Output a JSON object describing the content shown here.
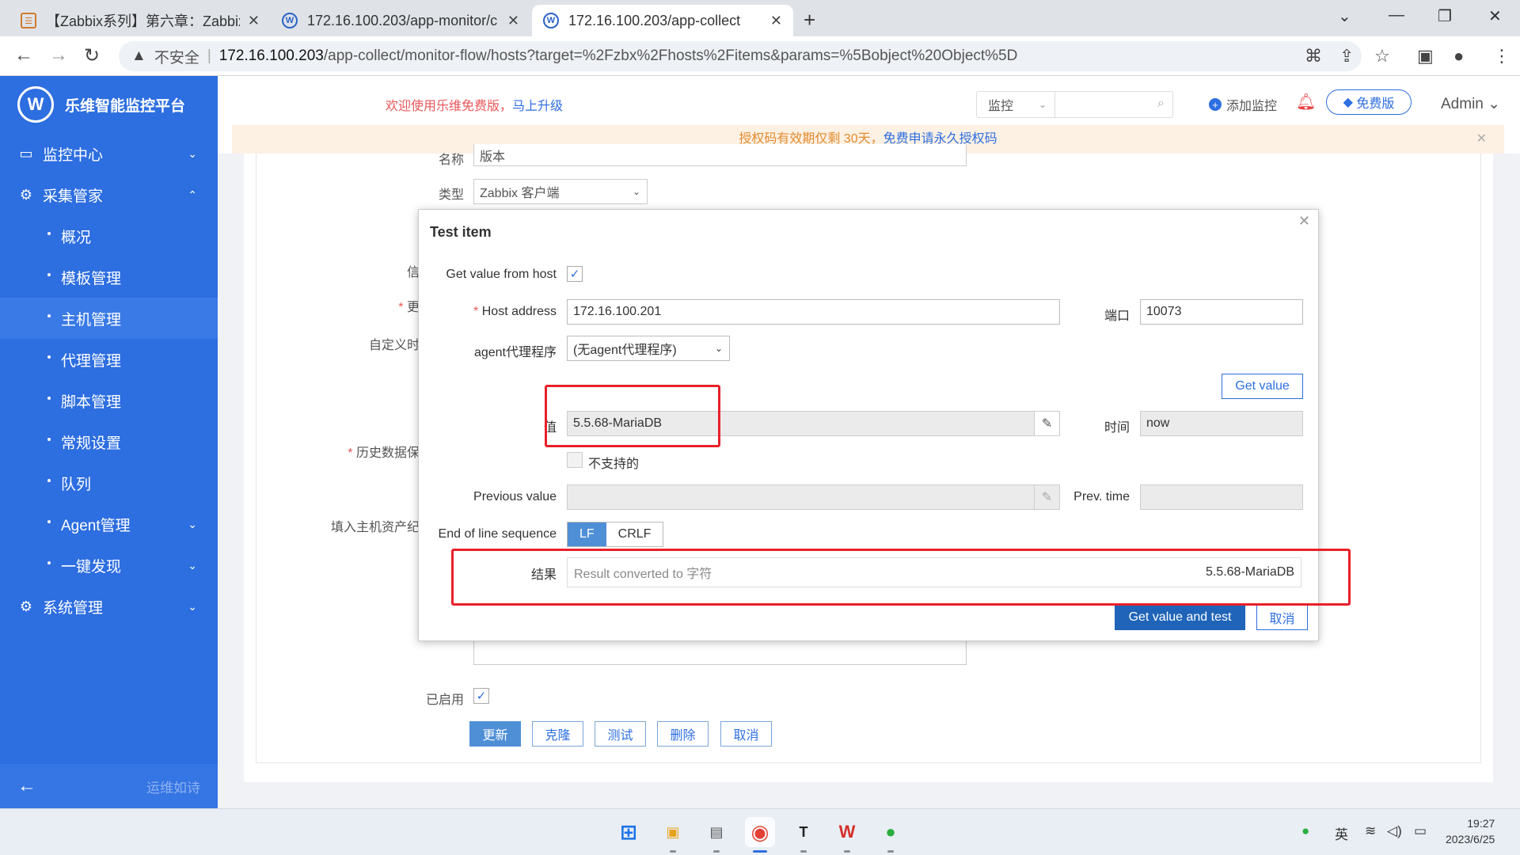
{
  "browser": {
    "tabs": [
      {
        "title": "【Zabbix系列】第六章：Zabbix",
        "active": false
      },
      {
        "title": "172.16.100.203/app-monitor/c",
        "active": false
      },
      {
        "title": "172.16.100.203/app-collect",
        "active": true
      }
    ],
    "security": "不安全",
    "url_host": "172.16.100.203",
    "url_path": "/app-collect/monitor-flow/hosts?target=%2Fzbx%2Fhosts%2Fitems&params=%5Bobject%20Object%5D"
  },
  "sidebar": {
    "brand": "乐维智能监控平台",
    "logo_letter": "W",
    "menu": [
      {
        "label": "监控中心",
        "icon": "monitor-icon",
        "expanded": false
      },
      {
        "label": "采集管家",
        "icon": "collect-icon",
        "expanded": true
      },
      {
        "label": "系统管理",
        "icon": "gear-icon",
        "expanded": false
      }
    ],
    "sub_items": [
      {
        "label": "概况"
      },
      {
        "label": "模板管理"
      },
      {
        "label": "主机管理",
        "active": true
      },
      {
        "label": "代理管理"
      },
      {
        "label": "脚本管理"
      },
      {
        "label": "常规设置"
      },
      {
        "label": "队列"
      },
      {
        "label": "Agent管理",
        "has_children": true
      },
      {
        "label": "一键发现",
        "has_children": true
      }
    ],
    "footer_motto": "运维如诗"
  },
  "topbar": {
    "welcome": "欢迎使用乐维免费版，",
    "upgrade_link": "马上升级",
    "search_scope": "监控",
    "search_placeholder": "",
    "add_monitor": "添加监控",
    "free_badge": "免费版",
    "user": "Admin"
  },
  "banner": {
    "text": "授权码有效期仅剩 30天，",
    "link": "免费申请永久授权码"
  },
  "form": {
    "name_label": "名称",
    "name_value": "版本",
    "type_label": "类型",
    "type_value": "Zabbix 客户端",
    "label_info": "信",
    "label_update": "更",
    "label_custom": "自定义时",
    "label_history": "历史数据保",
    "label_inventory": "填入主机资产纪",
    "enabled_label": "已启用",
    "buttons": {
      "update": "更新",
      "clone": "克隆",
      "test": "测试",
      "delete": "删除",
      "cancel": "取消"
    }
  },
  "modal": {
    "title": "Test item",
    "get_value_from_host": "Get value from host",
    "host_address_label": "Host address",
    "host_address": "172.16.100.201",
    "port_label": "端口",
    "port": "10073",
    "proxy_label": "agent代理程序",
    "proxy_value": "(无agent代理程序)",
    "get_value_btn": "Get value",
    "value_label": "值",
    "value": "5.5.68-MariaDB",
    "time_label": "时间",
    "time_value": "now",
    "unsupported_label": "不支持的",
    "prev_value_label": "Previous value",
    "prev_value": "",
    "prev_time_label": "Prev. time",
    "prev_time": "",
    "eol_label": "End of line sequence",
    "eol_options": [
      "LF",
      "CRLF"
    ],
    "eol_selected": "LF",
    "result_label": "结果",
    "result_hint": "Result converted to 字符",
    "result_value": "5.5.68-MariaDB",
    "test_btn": "Get value and test",
    "cancel_btn": "取消"
  },
  "taskbar": {
    "apps": [
      "windows-start-icon",
      "files-icon",
      "desktop-app-icon",
      "chrome-icon",
      "typora-icon",
      "wps-icon",
      "wechat-icon"
    ],
    "ime": "英",
    "time": "19:27",
    "date": "2023/6/25"
  }
}
